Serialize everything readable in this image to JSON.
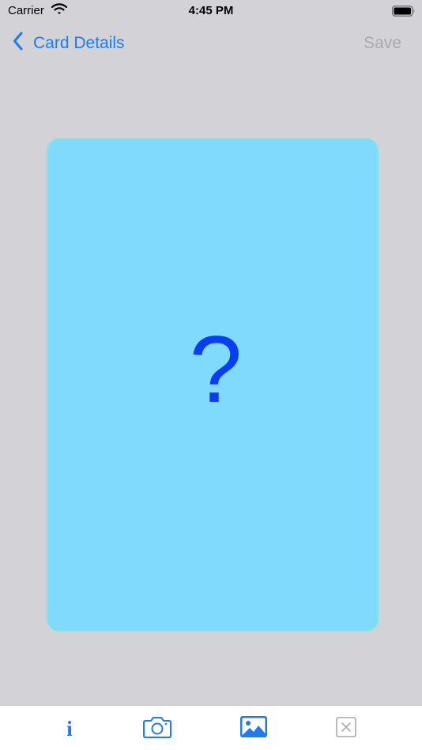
{
  "status_bar": {
    "carrier": "Carrier",
    "time": "4:45 PM",
    "wifi_icon": "wifi-icon",
    "battery_icon": "battery-full-icon"
  },
  "nav": {
    "back_label": "Card Details",
    "back_icon": "chevron-left-icon",
    "save_label": "Save"
  },
  "card": {
    "placeholder_symbol": "?",
    "background_color": "#7fdafe",
    "border_color": "#7ee6e8",
    "symbol_color": "#0a3ef5"
  },
  "toolbar": {
    "items": [
      {
        "icon": "info-icon",
        "glyph": "i"
      },
      {
        "icon": "camera-icon"
      },
      {
        "icon": "photo-icon"
      },
      {
        "icon": "delete-box-icon"
      }
    ]
  },
  "colors": {
    "accent": "#1f7bf0",
    "disabled": "#a9a9ae",
    "background": "#d2d2d7"
  }
}
